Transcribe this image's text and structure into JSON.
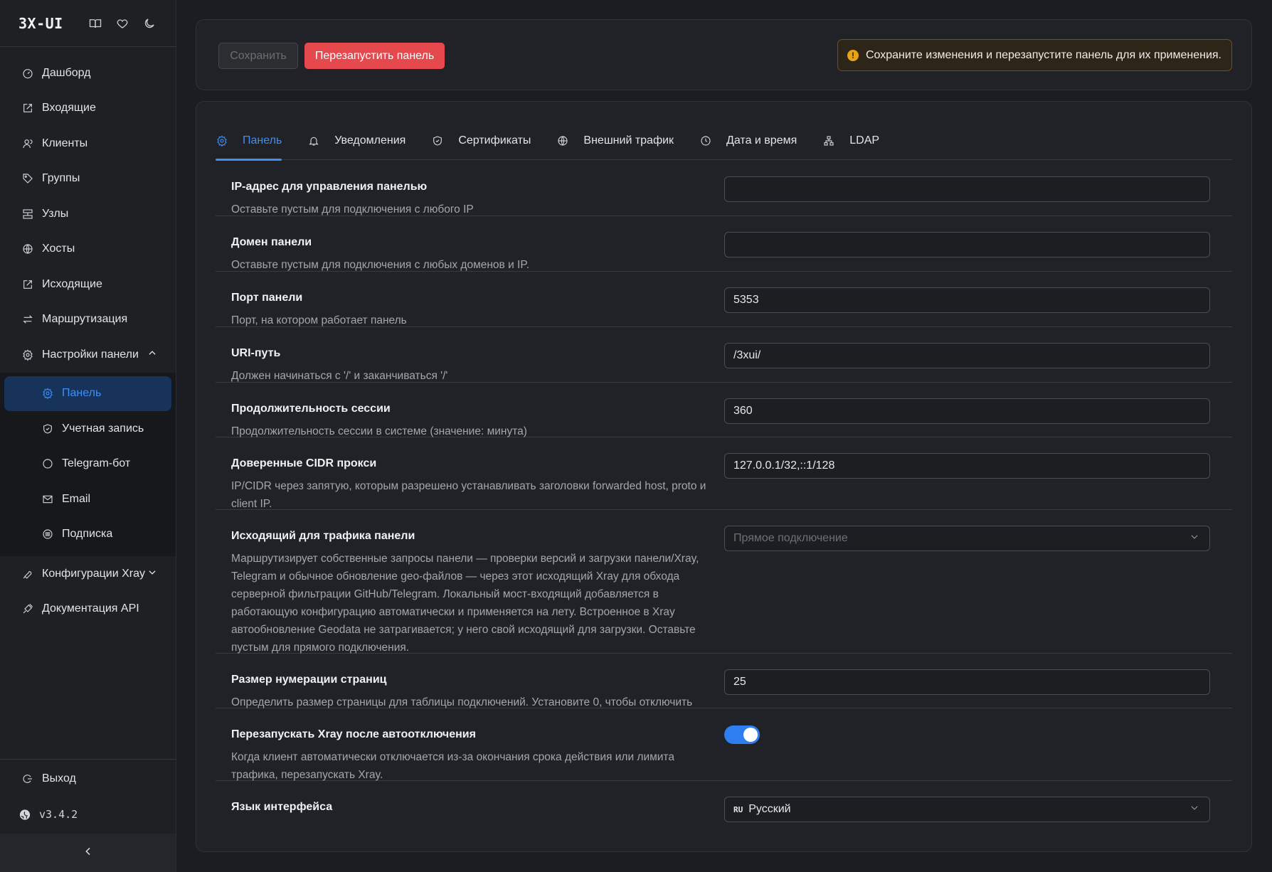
{
  "sidebar": {
    "brand": "3X-UI",
    "header_icons": [
      "book-icon",
      "heart-icon",
      "moon-icon"
    ],
    "items": [
      {
        "label": "Дашборд",
        "icon": "dashboard-icon"
      },
      {
        "label": "Входящие",
        "icon": "inbound-icon"
      },
      {
        "label": "Клиенты",
        "icon": "users-icon"
      },
      {
        "label": "Группы",
        "icon": "tag-icon"
      },
      {
        "label": "Узлы",
        "icon": "nodes-icon"
      },
      {
        "label": "Хосты",
        "icon": "globe-icon"
      },
      {
        "label": "Исходящие",
        "icon": "outbound-icon"
      },
      {
        "label": "Маршрутизация",
        "icon": "swap-icon"
      },
      {
        "label": "Настройки панели",
        "icon": "gear-icon"
      }
    ],
    "submenu": [
      {
        "label": "Панель",
        "icon": "gear-icon"
      },
      {
        "label": "Учетная запись",
        "icon": "shield-icon"
      },
      {
        "label": "Telegram-бот",
        "icon": "chat-icon"
      },
      {
        "label": "Email",
        "icon": "mail-icon"
      },
      {
        "label": "Подписка",
        "icon": "subscription-icon"
      }
    ],
    "after_items": [
      {
        "label": "Конфигурации Xray",
        "icon": "tool-icon"
      },
      {
        "label": "Документация API",
        "icon": "api-icon"
      }
    ],
    "logout": "Выход",
    "version": "v3.4.2"
  },
  "toolbar": {
    "save_label": "Сохранить",
    "restart_label": "Перезапустить панель",
    "alert_text": "Сохраните изменения и перезапустите панель для их применения."
  },
  "tabs": [
    {
      "label": "Панель",
      "icon": "gear-icon",
      "active": true
    },
    {
      "label": "Уведомления",
      "icon": "bell-icon"
    },
    {
      "label": "Сертификаты",
      "icon": "shield-icon"
    },
    {
      "label": "Внешний трафик",
      "icon": "globe-icon"
    },
    {
      "label": "Дата и время",
      "icon": "clock-icon"
    },
    {
      "label": "LDAP",
      "icon": "ldap-icon"
    }
  ],
  "settings": [
    {
      "label": "IP-адрес для управления панелью",
      "desc": "Оставьте пустым для подключения с любого IP",
      "value": ""
    },
    {
      "label": "Домен панели",
      "desc": "Оставьте пустым для подключения с любых доменов и IP.",
      "value": ""
    },
    {
      "label": "Порт панели",
      "desc": "Порт, на котором работает панель",
      "value": "5353"
    },
    {
      "label": "URI-путь",
      "desc": "Должен начинаться с '/' и заканчиваться '/'",
      "value": "/3xui/"
    },
    {
      "label": "Продолжительность сессии",
      "desc": "Продолжительность сессии в системе (значение: минута)",
      "value": "360"
    },
    {
      "label": "Доверенные CIDR прокси",
      "desc": "IP/CIDR через запятую, которым разрешено устанавливать заголовки forwarded host, proto и client IP.",
      "value": "127.0.0.1/32,::1/128"
    },
    {
      "label": "Исходящий для трафика панели",
      "desc": "Маршрутизирует собственные запросы панели — проверки версий и загрузки панели/Xray, Telegram и обычное обновление geo-файлов — через этот исходящий Xray для обхода серверной фильтрации GitHub/Telegram. Локальный мост-входящий добавляется в работающую конфигурацию автоматически и применяется на лету. Встроенное в Xray автообновление Geodata не затрагивается; у него свой исходящий для загрузки. Оставьте пустым для прямого подключения.",
      "placeholder": "Прямое подключение"
    },
    {
      "label": "Размер нумерации страниц",
      "desc": "Определить размер страницы для таблицы подключений. Установите 0, чтобы отключить",
      "value": "25"
    },
    {
      "label": "Перезапускать Xray после автоотключения",
      "desc": "Когда клиент автоматически отключается из-за окончания срока действия или лимита трафика, перезапускать Xray.",
      "enabled": true
    },
    {
      "label": "Язык интерфейса",
      "desc": "",
      "flag": "RU",
      "value": "Русский"
    }
  ]
}
